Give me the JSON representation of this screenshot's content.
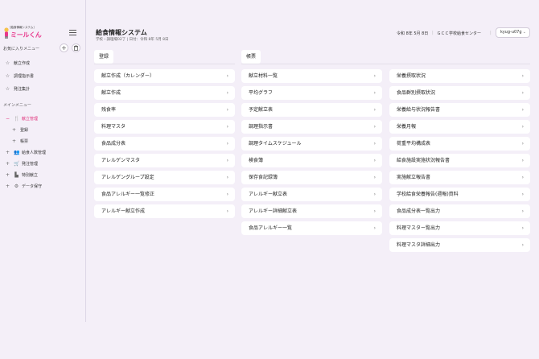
{
  "logo": {
    "sub": "［給食情報システム］",
    "main": "ミールくん"
  },
  "sidebar": {
    "favorites_title": "お気に入りメニュー",
    "favorites": [
      {
        "icon": "star-icon",
        "label": "献立作成"
      },
      {
        "icon": "star-icon",
        "label": "調理指示書"
      },
      {
        "icon": "star-icon",
        "label": "発注集計"
      }
    ],
    "main_menu_title": "メインメニュー",
    "menu": [
      {
        "icon": "minus-icon",
        "glyph": "−",
        "label": "献立管理",
        "active": true
      },
      {
        "icon": "plus-icon",
        "glyph": "＋",
        "label": "登録",
        "sub": true
      },
      {
        "icon": "plus-icon",
        "glyph": "＋",
        "label": "帳票",
        "sub": true
      },
      {
        "icon": "plus-icon",
        "glyph": "＋",
        "label": "給食人数管理"
      },
      {
        "icon": "plus-icon",
        "glyph": "＋",
        "label": "発注管理"
      },
      {
        "icon": "plus-icon",
        "glyph": "＋",
        "label": "特別献立"
      },
      {
        "icon": "plus-icon",
        "glyph": "＋",
        "label": "データ保守"
      }
    ]
  },
  "header": {
    "title": "給食情報システム",
    "subtitle": "学校・調理場02了 | 日付：令和 8年 5月 8日",
    "date": "令和 8年 5月 8日",
    "center": "ＧＣＣ学校給食センター",
    "user": "kyug-u07g"
  },
  "tabs": {
    "register": "登録",
    "reports": "帳票"
  },
  "columns": {
    "register": [
      "献立作成（カレンダー）",
      "献立作成",
      "残食率",
      "料理マスタ",
      "食品成分表",
      "アレルゲンマスタ",
      "アレルゲングループ設定",
      "食品アレルギー一覧修正",
      "アレルギー献立作成"
    ],
    "reports1": [
      "献立材料一覧",
      "平均グラフ",
      "予定献立表",
      "調理指示書",
      "調理タイムスケジュール",
      "検食簿",
      "保存食記録簿",
      "アレルギー献立表",
      "アレルギー詳細献立表",
      "食品アレルギー一覧"
    ],
    "reports2": [
      "栄養摂取状況",
      "食品群別摂取状況",
      "栄養給与状況報告書",
      "栄養月報",
      "荷重平均構成表",
      "給食施設実施状況報告書",
      "実施献立報告書",
      "学校給食栄養報告(週報)資料",
      "食品成分表一覧出力",
      "料理マスター覧出力",
      "料理マスタ詳細出力"
    ]
  }
}
